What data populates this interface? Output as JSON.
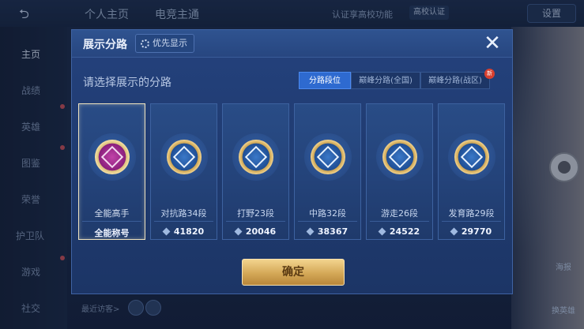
{
  "background": {
    "top_tabs": [
      "个人主页",
      "电竞主通"
    ],
    "verify_link": "认证享高校功能",
    "school_badge": "高校认证",
    "settings_label": "设置",
    "side_nav": [
      "主页",
      "战绩",
      "英雄",
      "图鉴",
      "荣誉",
      "护卫队",
      "游戏",
      "社交"
    ],
    "right_labels": [
      "海报",
      "换英雄"
    ],
    "recent_visitors": "最近访客>"
  },
  "modal": {
    "title": "展示分路",
    "priority_label": "优先显示",
    "close_symbol": "✕",
    "subtitle": "请选择展示的分路",
    "tabs": [
      {
        "label": "分路段位",
        "active": true
      },
      {
        "label": "巅峰分路(全国)",
        "active": false
      },
      {
        "label": "巅峰分路(战区)",
        "active": false,
        "badge": "新"
      }
    ],
    "cards": [
      {
        "name": "全能高手",
        "value": "全能称号",
        "selected": true,
        "icon": "all-round-emblem-icon"
      },
      {
        "name": "对抗路34段",
        "value": "41820",
        "selected": false,
        "icon": "clash-lane-emblem-icon"
      },
      {
        "name": "打野23段",
        "value": "20046",
        "selected": false,
        "icon": "jungle-emblem-icon"
      },
      {
        "name": "中路32段",
        "value": "38367",
        "selected": false,
        "icon": "mid-lane-emblem-icon"
      },
      {
        "name": "游走26段",
        "value": "24522",
        "selected": false,
        "icon": "roam-emblem-icon"
      },
      {
        "name": "发育路29段",
        "value": "29770",
        "selected": false,
        "icon": "farm-lane-emblem-icon"
      }
    ],
    "confirm_label": "确定"
  }
}
